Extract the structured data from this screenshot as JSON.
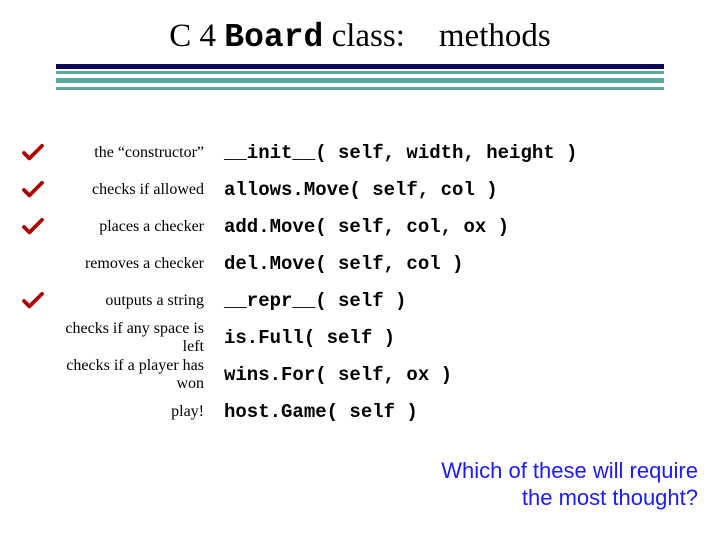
{
  "title": {
    "pre": "C 4 ",
    "mono": "Board",
    "post": " class:",
    "methods": "methods"
  },
  "rows": [
    {
      "check": true,
      "desc": "the “constructor”",
      "code": "__init__( self, width, height )"
    },
    {
      "check": true,
      "desc": "checks if allowed",
      "code": "allows.Move( self, col )"
    },
    {
      "check": true,
      "desc": "places a checker",
      "code": "add.Move( self, col, ox )"
    },
    {
      "check": false,
      "desc": "removes a checker",
      "code": "del.Move( self, col )"
    },
    {
      "check": true,
      "desc": "outputs a string",
      "code": "__repr__( self )"
    },
    {
      "check": false,
      "desc": "checks if any space is left",
      "code": "is.Full( self )"
    },
    {
      "check": false,
      "desc": "checks if a player has won",
      "code": "wins.For( self, ox )"
    },
    {
      "check": false,
      "desc": "play!",
      "code": "host.Game( self )"
    }
  ],
  "question": {
    "line1": "Which of these will require",
    "line2": "the most thought?"
  }
}
